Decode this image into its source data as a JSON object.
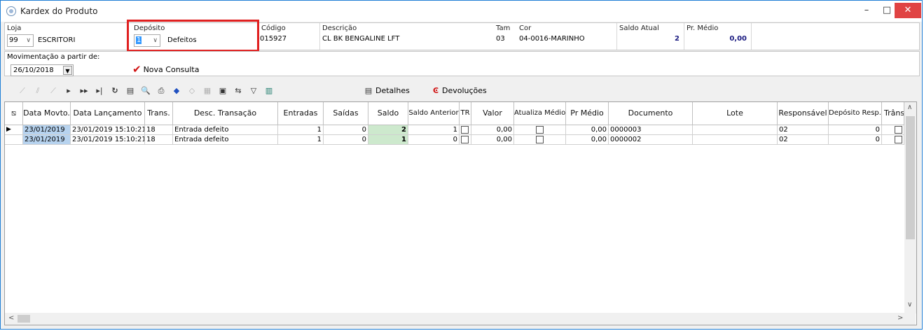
{
  "window": {
    "title": "Kardex do Produto",
    "min": "–",
    "max": "□",
    "close": "✕"
  },
  "top": {
    "loja": {
      "label": "Loja",
      "code": "99",
      "name": "ESCRITORI"
    },
    "deposito": {
      "label": "Depósito",
      "code": "1",
      "name": "Defeitos"
    },
    "codigo": {
      "label": "Código",
      "value": "015927"
    },
    "descricao": {
      "label": "Descrição",
      "value": "CL BK BENGALINE LFT"
    },
    "tam": {
      "label": "Tam",
      "value": "03"
    },
    "cor": {
      "label": "Cor",
      "value": "04-0016-MARINHO"
    },
    "saldo_atual": {
      "label": "Saldo Atual",
      "value": "2"
    },
    "pr_medio": {
      "label": "Pr. Médio",
      "value": "0,00"
    }
  },
  "movimentacao": {
    "label": "Movimentação a partir de:",
    "date": "26/10/2018",
    "nova_consulta": "Nova Consulta"
  },
  "toolbar": {
    "detalhes": "Detalhes",
    "devolucoes": "Devoluções"
  },
  "grid": {
    "headers": [
      "Data Movto.",
      "Data Lançamento",
      "Trans.",
      "Desc. Transação",
      "Entradas",
      "Saídas",
      "Saldo",
      "Saldo Anterior",
      "TR",
      "Valor",
      "Atualiza Médio",
      "Pr Médio",
      "Documento",
      "Lote",
      "Responsável",
      "Depósito Resp.",
      "Trâns"
    ],
    "rows": [
      {
        "data_movto": "23/01/2019",
        "data_lanc": "23/01/2019 15:10:21",
        "trans": "18",
        "desc": "Entrada defeito",
        "entradas": "1",
        "saidas": "0",
        "saldo": "2",
        "saldo_ant": "1",
        "valor": "0,00",
        "pr_medio": "0,00",
        "documento": "0000003",
        "lote": "",
        "responsavel": "02",
        "dep_resp": "0"
      },
      {
        "data_movto": "23/01/2019",
        "data_lanc": "23/01/2019 15:10:21",
        "trans": "18",
        "desc": "Entrada defeito",
        "entradas": "1",
        "saidas": "0",
        "saldo": "1",
        "saldo_ant": "0",
        "valor": "0,00",
        "pr_medio": "0,00",
        "documento": "0000002",
        "lote": "",
        "responsavel": "02",
        "dep_resp": "0"
      }
    ]
  }
}
